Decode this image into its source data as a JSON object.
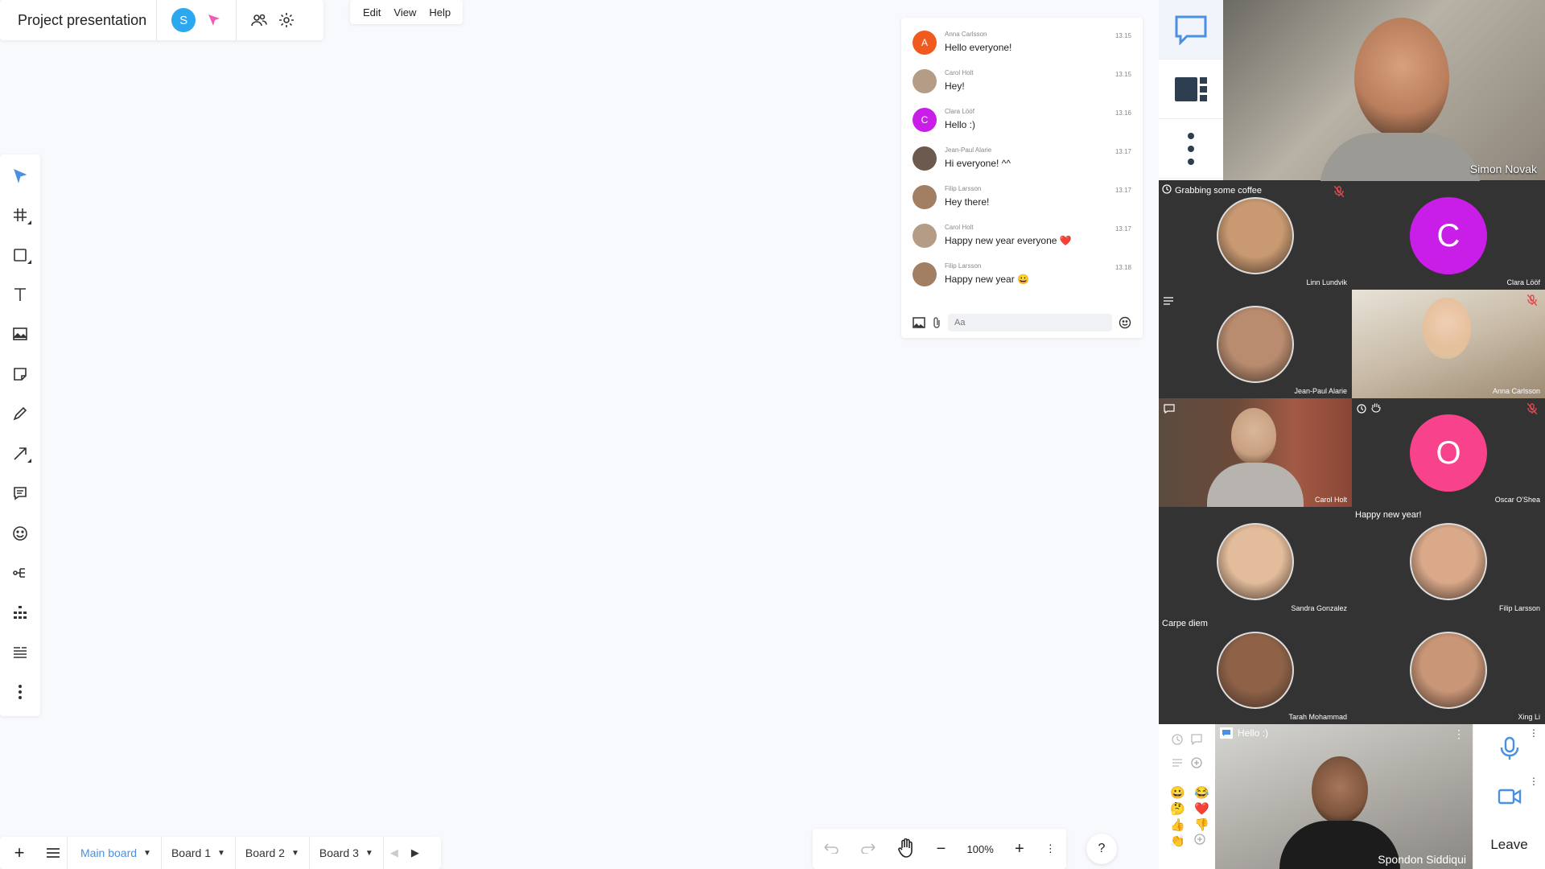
{
  "header": {
    "title": "Project presentation",
    "user_initial": "S",
    "menu": [
      "Edit",
      "View",
      "Help"
    ]
  },
  "toolbar": {
    "tools": [
      "select",
      "grid",
      "shape",
      "text",
      "image",
      "sticky-note",
      "pen",
      "arrow",
      "comment",
      "emoji",
      "mindmap",
      "org-chart",
      "list",
      "more"
    ]
  },
  "chat": {
    "messages": [
      {
        "name": "Anna Carlsson",
        "text": "Hello everyone!",
        "time": "13.15",
        "avatar": "A",
        "color": "#f05a1e"
      },
      {
        "name": "Carol Holt",
        "text": "Hey!",
        "time": "13.15",
        "avatar": "",
        "color": "#b59c86"
      },
      {
        "name": "Clara Lööf",
        "text": "Hello :)",
        "time": "13.16",
        "avatar": "C",
        "color": "#c91de8"
      },
      {
        "name": "Jean-Paul Alarie",
        "text": "Hi everyone! ^^",
        "time": "13.17",
        "avatar": "",
        "color": "#6b5a4d"
      },
      {
        "name": "Filip Larsson",
        "text": "Hey there!",
        "time": "13.17",
        "avatar": "",
        "color": "#a27e63"
      },
      {
        "name": "Carol Holt",
        "text": "Happy new year everyone ❤️",
        "time": "13.17",
        "avatar": "",
        "color": "#b59c86"
      },
      {
        "name": "Filip Larsson",
        "text": "Happy new year 😀",
        "time": "13.18",
        "avatar": "",
        "color": "#a27e63"
      }
    ],
    "input_placeholder": "Aa"
  },
  "video": {
    "main_speaker": "Simon Novak",
    "tiles": [
      {
        "name": "Linn Lundvik",
        "status": "Grabbing some coffee",
        "muted": true,
        "type": "face",
        "tone": "#c99a72"
      },
      {
        "name": "Clara Lööf",
        "letter": "C",
        "type": "letter",
        "color": "#c91de8"
      },
      {
        "name": "Jean-Paul Alarie",
        "type": "face",
        "tone": "#b98c6f",
        "note_icon": true
      },
      {
        "name": "Anna Carlsson",
        "type": "scene",
        "muted": true
      },
      {
        "name": "Carol Holt",
        "type": "scene2",
        "chat_icon": true
      },
      {
        "name": "Oscar O'Shea",
        "letter": "O",
        "type": "letter",
        "color": "#f9428c",
        "muted": true
      },
      {
        "name": "Sandra Gonzalez",
        "type": "face",
        "tone": "#e2bc9b"
      },
      {
        "name": "Filip Larsson",
        "status": "Happy new year!",
        "type": "face",
        "tone": "#d9a98a"
      },
      {
        "name": "Tarah Mohammad",
        "status": "Carpe diem",
        "type": "face",
        "tone": "#8f6248"
      },
      {
        "name": "Xing Li",
        "type": "face",
        "tone": "#c99677"
      }
    ],
    "self": {
      "name": "Spondon Siddiqui",
      "status": "Hello :)"
    }
  },
  "reactions": [
    "😀",
    "😂",
    "🤔",
    "❤️",
    "👍",
    "👎",
    "👏"
  ],
  "controls": {
    "leave": "Leave"
  },
  "boards": [
    "Main board",
    "Board 1",
    "Board 2",
    "Board 3"
  ],
  "zoom": {
    "level": "100%"
  },
  "help": "?"
}
